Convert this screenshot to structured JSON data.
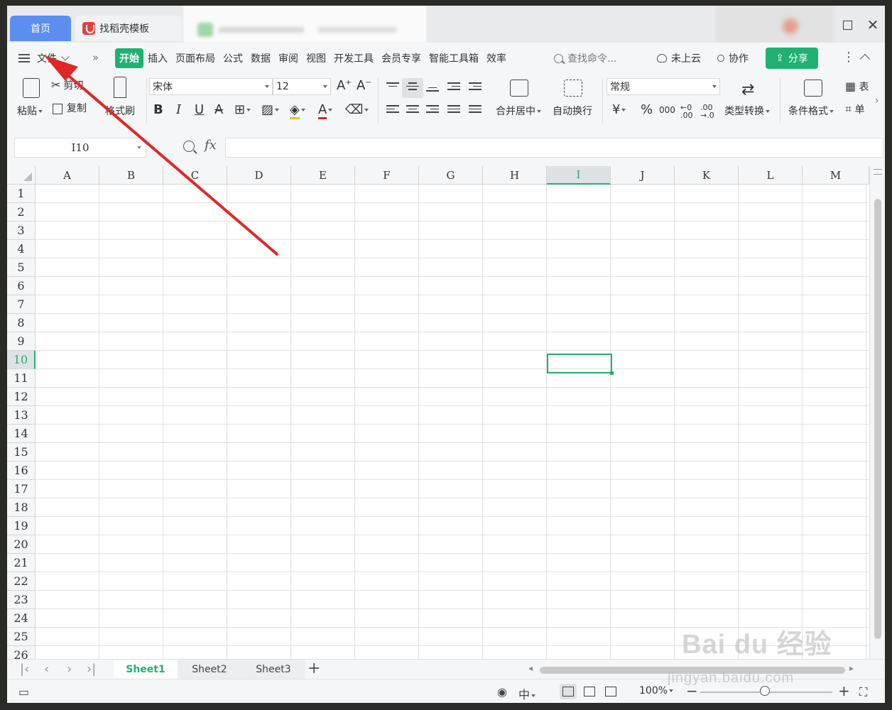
{
  "titlebar": {
    "home_tab": "首页",
    "doc_tab": "找稻壳模板"
  },
  "menubar": {
    "file_label": "文件",
    "more": "»",
    "items": [
      "开始",
      "插入",
      "页面布局",
      "公式",
      "数据",
      "审阅",
      "视图",
      "开发工具",
      "会员专享",
      "智能工具箱",
      "效率"
    ],
    "search_placeholder": "查找命令...",
    "cloud_label": "未上云",
    "collab_label": "协作",
    "share_label": "分享",
    "accent": "#1fb171"
  },
  "ribbon": {
    "paste": "粘贴",
    "cut": "剪切",
    "copy": "复制",
    "format_painter": "格式刷",
    "font_name": "宋体",
    "font_size": "12",
    "merge_center": "合并居中",
    "wrap_text": "自动换行",
    "number_format": "常规",
    "currency_symbol": "¥",
    "percent_symbol": "%",
    "thousands_symbol": "000",
    "type_convert": "类型转换",
    "cond_format": "条件格式",
    "table_style": "表",
    "cell_label": "单",
    "bold": "B",
    "italic": "I",
    "underline": "U"
  },
  "formula_bar": {
    "cell_ref": "I10",
    "fx": "fx",
    "formula": ""
  },
  "grid": {
    "columns": [
      "A",
      "B",
      "C",
      "D",
      "E",
      "F",
      "G",
      "H",
      "I",
      "J",
      "K",
      "L",
      "M"
    ],
    "rows": [
      "1",
      "2",
      "3",
      "4",
      "5",
      "6",
      "7",
      "8",
      "9",
      "10",
      "11",
      "12",
      "13",
      "14",
      "15",
      "16",
      "17",
      "18",
      "19",
      "20",
      "21",
      "22",
      "23",
      "24",
      "25",
      "26"
    ],
    "selected_column": "I",
    "selected_row": "10"
  },
  "sheets": {
    "tabs": [
      "Sheet1",
      "Sheet2",
      "Sheet3"
    ],
    "active": "Sheet1",
    "add": "+"
  },
  "statusbar": {
    "zoom": "100%",
    "zoom_out": "−",
    "zoom_in": "+"
  },
  "watermark": {
    "brand": "Bai du 经验",
    "url": "jingyan.baidu.com"
  }
}
